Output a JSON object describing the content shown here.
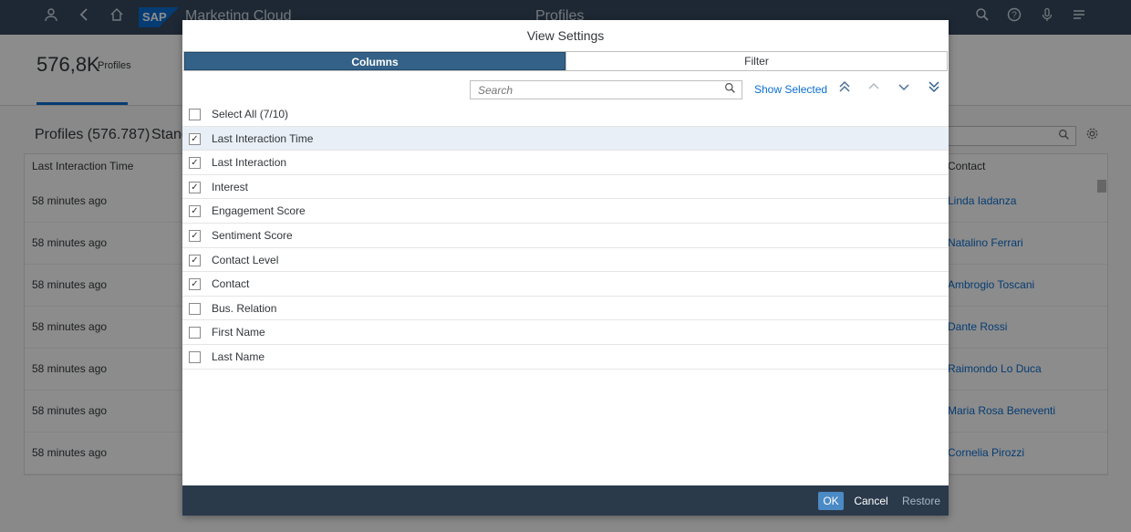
{
  "shell": {
    "title": "Marketing Cloud",
    "center_title": "Profiles",
    "logo_text": "SAP",
    "icons": [
      "user-icon",
      "back-icon",
      "home-icon",
      "search-icon",
      "help-icon",
      "microphone-icon",
      "menu-icon"
    ]
  },
  "header": {
    "kpi_value": "576,8K",
    "kpi_unit": "Profiles"
  },
  "table": {
    "title": "Profiles (576.787)",
    "title_partial": "Stand",
    "columns": [
      "Last Interaction Time",
      "Contact"
    ],
    "rows": [
      {
        "time": "58 minutes ago",
        "contact": "Linda Iadanza"
      },
      {
        "time": "58 minutes ago",
        "contact": "Natalino Ferrari"
      },
      {
        "time": "58 minutes ago",
        "contact": "Ambrogio Toscani"
      },
      {
        "time": "58 minutes ago",
        "contact": "Dante Rossi"
      },
      {
        "time": "58 minutes ago",
        "contact": "Raimondo Lo Duca"
      },
      {
        "time": "58 minutes ago",
        "contact": "Maria Rosa Beneventi"
      },
      {
        "time": "58 minutes ago",
        "contact": "Cornelia Pirozzi"
      }
    ]
  },
  "dialog": {
    "title": "View Settings",
    "tabs": {
      "columns": "Columns",
      "filter": "Filter"
    },
    "search_placeholder": "Search",
    "show_selected": "Show Selected",
    "select_all": "Select All (7/10)",
    "items": [
      {
        "label": "Last Interaction Time",
        "checked": true
      },
      {
        "label": "Last Interaction",
        "checked": true
      },
      {
        "label": "Interest",
        "checked": true
      },
      {
        "label": "Engagement Score",
        "checked": true
      },
      {
        "label": "Sentiment Score",
        "checked": true
      },
      {
        "label": "Contact Level",
        "checked": true
      },
      {
        "label": "Contact",
        "checked": true
      },
      {
        "label": "Bus. Relation",
        "checked": false
      },
      {
        "label": "First Name",
        "checked": false
      },
      {
        "label": "Last Name",
        "checked": false
      }
    ],
    "buttons": {
      "ok": "OK",
      "cancel": "Cancel",
      "restore": "Restore"
    }
  },
  "colors": {
    "shell": "#354a5f",
    "brand": "#0a6ed1",
    "active_tab": "#346187",
    "footer": "#2a3a4b",
    "ok_button": "#4b8ac4"
  }
}
